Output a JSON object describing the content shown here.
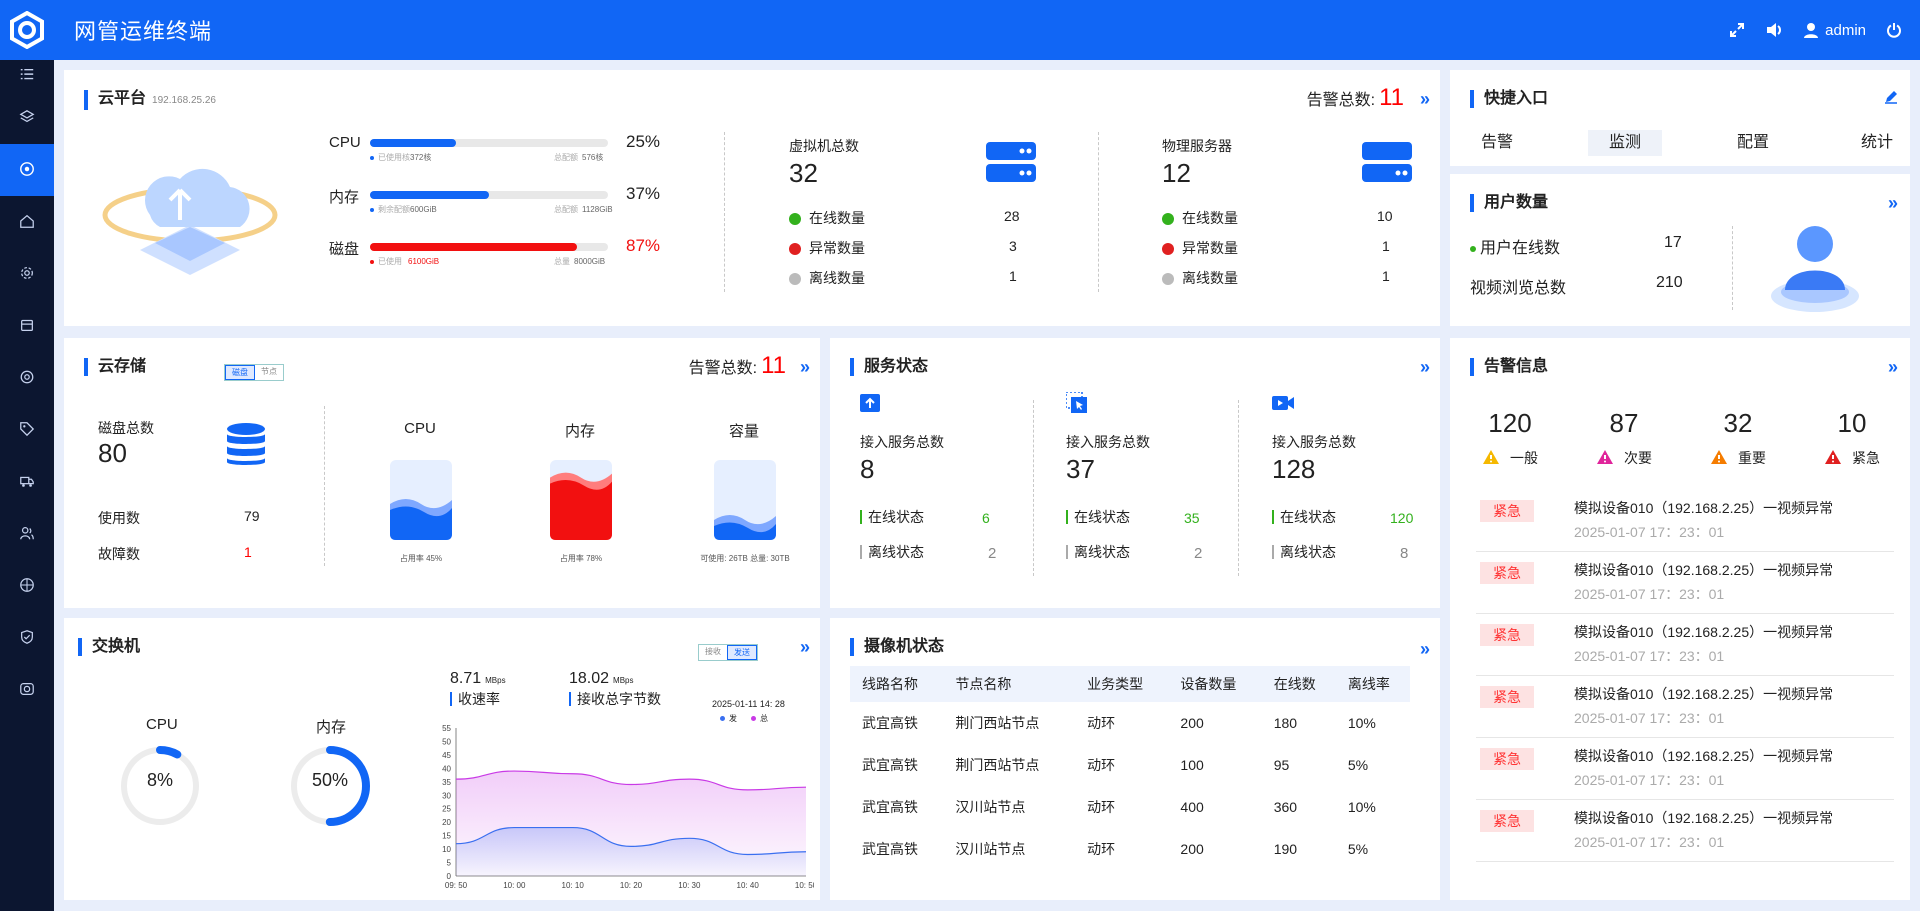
{
  "app": {
    "title": "网管运维终端",
    "user": "admin"
  },
  "sidebar": {
    "items": [
      "list-icon",
      "layers-icon",
      "dashboard-icon",
      "home-icon",
      "gear-icon",
      "box-icon",
      "target-icon",
      "tag-icon",
      "truck-icon",
      "users-icon",
      "network-icon",
      "shield-icon",
      "camera-icon"
    ],
    "active_index": 2
  },
  "cloud_platform": {
    "title": "云平台",
    "ip": "192.168.25.26",
    "alarm_label": "告警总数:",
    "alarm_count": "11",
    "resources": [
      {
        "name": "CPU",
        "percent": "25%",
        "fill": 0.36,
        "color": "#1166f5",
        "left_label": "已使用核",
        "left_value": "372核",
        "right_label": "总配额",
        "right_value": "576核"
      },
      {
        "name": "内存",
        "percent": "37%",
        "fill": 0.5,
        "color": "#1166f5",
        "left_label": "剩余配额",
        "left_value": "600GiB",
        "right_label": "总配额",
        "right_value": "1128GiB"
      },
      {
        "name": "磁盘",
        "percent": "87%",
        "fill": 0.87,
        "color": "#f21010",
        "left_label": "已使用",
        "left_value": "6100GiB",
        "right_label": "总量",
        "right_value": "8000GiB"
      }
    ],
    "vm": {
      "title": "虚拟机总数",
      "total": "32",
      "online_label": "在线数量",
      "online": "28",
      "abnormal_label": "异常数量",
      "abnormal": "3",
      "offline_label": "离线数量",
      "offline": "1"
    },
    "physical": {
      "title": "物理服务器",
      "total": "12",
      "online_label": "在线数量",
      "online": "10",
      "abnormal_label": "异常数量",
      "abnormal": "1",
      "offline_label": "离线数量",
      "offline": "1"
    }
  },
  "quick_entry": {
    "title": "快捷入口",
    "items": [
      "告警",
      "监测",
      "配置",
      "统计"
    ],
    "active_index": 1
  },
  "user_count": {
    "title": "用户数量",
    "online_label": "用户在线数",
    "online": "17",
    "views_label": "视频浏览总数",
    "views": "210"
  },
  "cloud_storage": {
    "title": "云存储",
    "tabs": [
      "磁盘",
      "节点"
    ],
    "alarm_label": "告警总数:",
    "alarm_count": "11",
    "disk_total_label": "磁盘总数",
    "disk_total": "80",
    "used_label": "使用数",
    "used": "79",
    "fault_label": "故障数",
    "fault": "1",
    "gauges": [
      {
        "name": "CPU",
        "caption": "占用率   45%",
        "level": 0.45,
        "color": "#1166f5"
      },
      {
        "name": "内存",
        "caption": "占用率   78%",
        "level": 0.78,
        "color": "#f21010"
      },
      {
        "name": "容量",
        "caption": "可使用: 26TB   总量: 30TB",
        "level": 0.25,
        "color": "#1166f5"
      }
    ]
  },
  "service_status": {
    "title": "服务状态",
    "groups": [
      {
        "icon": "upload-icon",
        "label": "接入服务总数",
        "total": "8",
        "online_label": "在线状态",
        "online": "6",
        "offline_label": "离线状态",
        "offline": "2"
      },
      {
        "icon": "cursor-icon",
        "label": "接入服务总数",
        "total": "37",
        "online_label": "在线状态",
        "online": "35",
        "offline_label": "离线状态",
        "offline": "2"
      },
      {
        "icon": "video-icon",
        "label": "接入服务总数",
        "total": "128",
        "online_label": "在线状态",
        "online": "120",
        "offline_label": "离线状态",
        "offline": "8"
      }
    ]
  },
  "alarm_info": {
    "title": "告警信息",
    "levels": [
      {
        "count": "120",
        "label": "一般",
        "color": "#f5b800"
      },
      {
        "count": "87",
        "label": "次要",
        "color": "#e0249b"
      },
      {
        "count": "32",
        "label": "重要",
        "color": "#f57c00"
      },
      {
        "count": "10",
        "label": "紧急",
        "color": "#e02020"
      }
    ],
    "rows": [
      {
        "tag": "紧急",
        "text": "模拟设备010（192.168.2.25）一视频异常",
        "time": "2025-01-07  17：23：01"
      },
      {
        "tag": "紧急",
        "text": "模拟设备010（192.168.2.25）一视频异常",
        "time": "2025-01-07  17：23：01"
      },
      {
        "tag": "紧急",
        "text": "模拟设备010（192.168.2.25）一视频异常",
        "time": "2025-01-07  17：23：01"
      },
      {
        "tag": "紧急",
        "text": "模拟设备010（192.168.2.25）一视频异常",
        "time": "2025-01-07  17：23：01"
      },
      {
        "tag": "紧急",
        "text": "模拟设备010（192.168.2.25）一视频异常",
        "time": "2025-01-07  17：23：01"
      },
      {
        "tag": "紧急",
        "text": "模拟设备010（192.168.2.25）一视频异常",
        "time": "2025-01-07  17：23：01"
      }
    ]
  },
  "switch": {
    "title": "交换机",
    "tabs": [
      "接收",
      "发送"
    ],
    "cpu_label": "CPU",
    "cpu": "8%",
    "cpu_level": 0.08,
    "mem_label": "内存",
    "mem": "50%",
    "mem_level": 0.5,
    "rx_rate": "8.71",
    "rx_unit": "MBps",
    "rx_label": "收速率",
    "rx_bytes": "18.02",
    "rx_bytes_unit": "MBps",
    "rx_bytes_label": "接收总字节数",
    "timestamp": "2025-01-11 14: 28",
    "legend": [
      "发",
      "总"
    ]
  },
  "chart_data": {
    "type": "area",
    "x": [
      "09: 50",
      "10: 00",
      "10: 10",
      "10: 20",
      "10: 30",
      "10: 40",
      "10: 50"
    ],
    "yticks": [
      0,
      5,
      10,
      15,
      20,
      25,
      30,
      35,
      40,
      45,
      50,
      55
    ],
    "ylim": [
      0,
      55
    ],
    "series": [
      {
        "name": "发",
        "color": "#3a6ff0",
        "values": [
          12,
          18,
          18,
          11,
          14,
          8,
          9
        ]
      },
      {
        "name": "总",
        "color": "#c93ae6",
        "values": [
          36,
          39,
          38,
          34,
          36,
          32,
          33
        ]
      }
    ]
  },
  "camera_status": {
    "title": "摄像机状态",
    "columns": [
      "线路名称",
      "节点名称",
      "业务类型",
      "设备数量",
      "在线数",
      "离线率"
    ],
    "rows": [
      [
        "武宜高铁",
        "荆门西站节点",
        "动环",
        "200",
        "180",
        "10%"
      ],
      [
        "武宜高铁",
        "荆门西站节点",
        "动环",
        "100",
        "95",
        "5%"
      ],
      [
        "武宜高铁",
        "汉川站节点",
        "动环",
        "400",
        "360",
        "10%"
      ],
      [
        "武宜高铁",
        "汉川站节点",
        "动环",
        "200",
        "190",
        "5%"
      ]
    ]
  }
}
